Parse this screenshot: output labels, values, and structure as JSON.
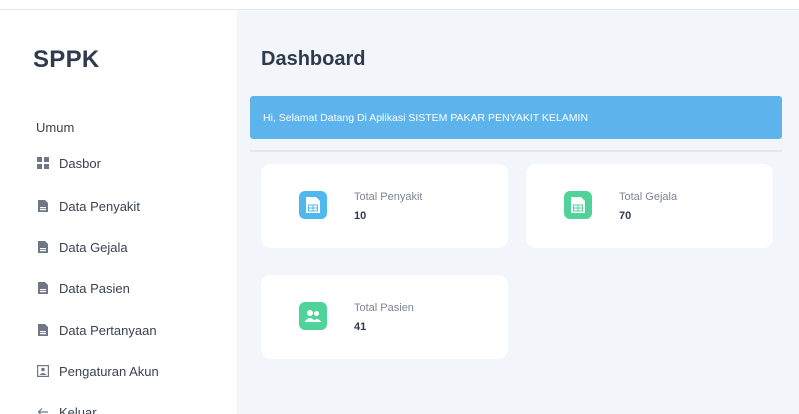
{
  "app": {
    "brand": "SPPK"
  },
  "sidebar": {
    "heading": "Umum",
    "items": [
      {
        "label": "Dasbor",
        "icon": "grid-icon"
      },
      {
        "label": "Data Penyakit",
        "icon": "file-icon"
      },
      {
        "label": "Data Gejala",
        "icon": "file-icon"
      },
      {
        "label": "Data Pasien",
        "icon": "file-icon"
      },
      {
        "label": "Data Pertanyaan",
        "icon": "file-icon"
      },
      {
        "label": "Pengaturan Akun",
        "icon": "user-card-icon"
      },
      {
        "label": "Keluar",
        "icon": "arrow-left-icon"
      }
    ]
  },
  "main": {
    "title": "Dashboard",
    "alert": "Hi, Selamat Datang Di Aplikasi SISTEM PAKAR PENYAKIT KELAMIN",
    "cards": [
      {
        "label": "Total Penyakit",
        "value": "10",
        "icon": "table-file-icon",
        "color": "#4fb8ec"
      },
      {
        "label": "Total Gejala",
        "value": "70",
        "icon": "table-file-icon",
        "color": "#4fd39a"
      },
      {
        "label": "Total Pasien",
        "value": "41",
        "icon": "users-icon",
        "color": "#4fd39a"
      }
    ]
  },
  "colors": {
    "accent": "#5db3ec",
    "background": "#f2f6fb",
    "text": "#2f3a4c"
  }
}
